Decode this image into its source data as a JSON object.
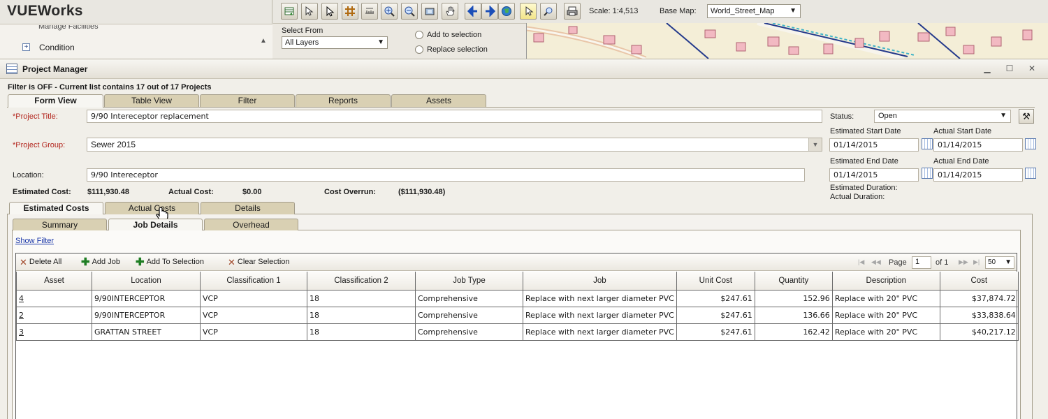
{
  "app": {
    "title": "VUEWorks"
  },
  "left_tree": {
    "cut_item": "Manage Facilities",
    "item": "Condition"
  },
  "toolbar": {
    "scale_label": "Scale: 1:4,513",
    "basemap_label": "Base Map:",
    "basemap_value": "World_Street_Map",
    "icons": [
      "table-refresh-icon",
      "select-arrow-icon",
      "pointer-icon",
      "grid-icon",
      "measure-icon",
      "zoom-in-icon",
      "zoom-out-icon",
      "full-extent-icon",
      "pan-hand-icon",
      "back-icon",
      "forward-icon",
      "globe-icon",
      "select-highlight-icon",
      "zoom-select-icon",
      "print-icon"
    ]
  },
  "select_panel": {
    "label": "Select From",
    "layer_value": "All Layers",
    "radio_add": "Add to selection",
    "radio_replace": "Replace selection"
  },
  "window": {
    "title": "Project Manager",
    "min": "▁",
    "max": "☐",
    "close": "✕"
  },
  "filter_status": "Filter is OFF -  Current list contains 17 out of 17 Projects",
  "main_tabs": [
    "Form View",
    "Table View",
    "Filter",
    "Reports",
    "Assets"
  ],
  "form": {
    "title_label": "*Project Title:",
    "title_value": "9/90 Intereceptor replacement",
    "group_label": "*Project Group:",
    "group_value": "Sewer 2015",
    "location_label": "Location:",
    "location_value": "9/90 Intereceptor",
    "est_cost_label": "Estimated Cost:",
    "est_cost_value": "$111,930.48",
    "actual_cost_label": "Actual Cost:",
    "actual_cost_value": "$0.00",
    "overrun_label": "Cost Overrun:",
    "overrun_value": "($111,930.48)",
    "status_label": "Status:",
    "status_value": "Open",
    "est_start_label": "Estimated Start Date",
    "est_start_value": "01/14/2015",
    "act_start_label": "Actual Start Date",
    "act_start_value": "01/14/2015",
    "est_end_label": "Estimated End Date",
    "est_end_value": "01/14/2015",
    "act_end_label": "Actual End Date",
    "act_end_value": "01/14/2015",
    "est_duration_label": "Estimated Duration:",
    "act_duration_label": "Actual Duration:"
  },
  "cost_tabs": [
    "Estimated Costs",
    "Actual Costs",
    "Details"
  ],
  "detail_tabs": [
    "Summary",
    "Job Details",
    "Overhead"
  ],
  "show_filter": "Show Filter",
  "grid_toolbar": {
    "delete_all": "Delete All",
    "add_job": "Add Job",
    "add_to_selection": "Add To Selection",
    "clear_selection": "Clear Selection",
    "page_label": "Page",
    "page_value": "1",
    "of_label": "of 1",
    "page_size": "50"
  },
  "columns": [
    "Asset",
    "Location",
    "Classification 1",
    "Classification 2",
    "Job Type",
    "Job",
    "Unit Cost",
    "Quantity",
    "Description",
    "Cost"
  ],
  "rows": [
    [
      "4",
      "9/90INTERCEPTOR",
      "VCP",
      "18",
      "Comprehensive",
      "Replace with next larger diameter PVC",
      "$247.61",
      "152.96",
      "Replace with 20\" PVC",
      "$37,874.72"
    ],
    [
      "2",
      "9/90INTERCEPTOR",
      "VCP",
      "18",
      "Comprehensive",
      "Replace with next larger diameter PVC",
      "$247.61",
      "136.66",
      "Replace with 20\" PVC",
      "$33,838.64"
    ],
    [
      "3",
      "GRATTAN STREET",
      "VCP",
      "18",
      "Comprehensive",
      "Replace with next larger diameter PVC",
      "$247.61",
      "162.42",
      "Replace with 20\" PVC",
      "$40,217.12"
    ]
  ]
}
